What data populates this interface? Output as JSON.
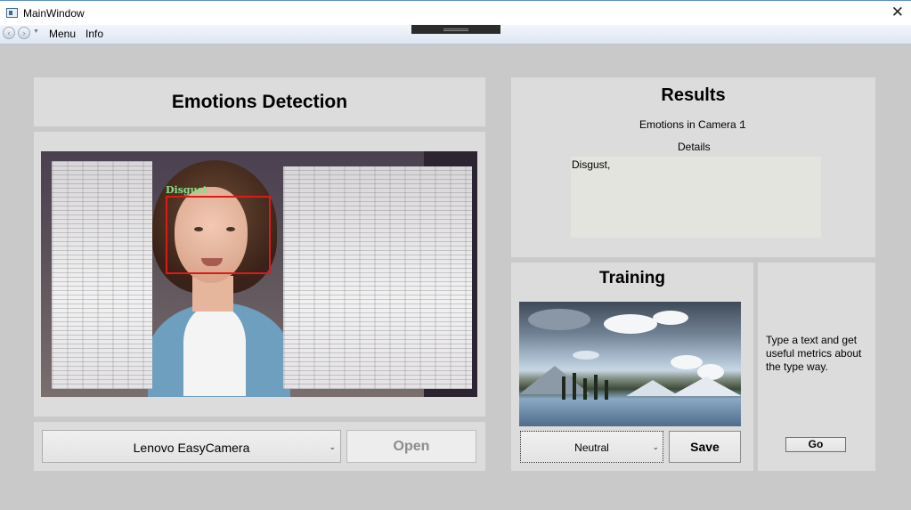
{
  "window": {
    "title": "MainWindow",
    "close_glyph": "✕"
  },
  "menubar": {
    "items": [
      "Menu",
      "Info"
    ]
  },
  "emotions_detection": {
    "title": "Emotions Detection",
    "face_label": "Disgust",
    "camera_select": "Lenovo EasyCamera",
    "open_label": "Open"
  },
  "results": {
    "title": "Results",
    "count_label": "Emotions in Camera :",
    "count_value": "1",
    "details_label": "Details",
    "details_text": "Disgust,"
  },
  "training": {
    "title": "Training",
    "emotion_select": "Neutral",
    "save_label": "Save"
  },
  "typing": {
    "description": "Type a text and get useful metrics about the type way.",
    "go_label": "Go"
  },
  "colors": {
    "face_box": "#e01818",
    "face_label": "#86e08a",
    "panel_bg": "#dcdcdc",
    "window_bg": "#c9c9c9"
  }
}
